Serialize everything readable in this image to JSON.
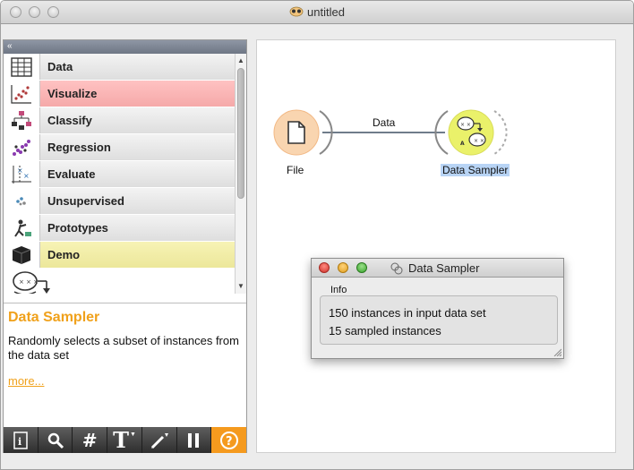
{
  "window": {
    "title": "untitled"
  },
  "sidebar": {
    "collapse_glyph": "«",
    "categories": [
      {
        "label": "Data",
        "icon": "data-table-icon"
      },
      {
        "label": "Visualize",
        "icon": "scatter-plot-icon",
        "color": "#f5a9a9"
      },
      {
        "label": "Classify",
        "icon": "tree-icon"
      },
      {
        "label": "Regression",
        "icon": "regression-icon"
      },
      {
        "label": "Evaluate",
        "icon": "evaluate-icon"
      },
      {
        "label": "Unsupervised",
        "icon": "unsupervised-icon"
      },
      {
        "label": "Prototypes",
        "icon": "prototypes-icon"
      },
      {
        "label": "Demo",
        "icon": "cube-icon",
        "color": "#ece79a"
      }
    ],
    "scroll_up": "▲",
    "scroll_down": "▼"
  },
  "description": {
    "title": "Data Sampler",
    "text": "Randomly selects a subset of instances from the data set",
    "more": "more..."
  },
  "toolbar": {
    "buttons": [
      "info-icon",
      "search-icon",
      "grid-icon",
      "text-icon",
      "pen-icon",
      "pause-icon",
      "help-icon"
    ],
    "text_glyph": "T",
    "grid_glyph": "#",
    "help_glyph": "?",
    "accent": "#f59a1e"
  },
  "canvas": {
    "nodes": [
      {
        "label": "File",
        "icon": "file-icon"
      },
      {
        "label": "Data Sampler",
        "icon": "data-sampler-icon"
      }
    ],
    "link_label": "Data"
  },
  "dialog": {
    "title": "Data Sampler",
    "group_label": "Info",
    "lines": [
      "150 instances in input data set",
      "15 sampled instances"
    ]
  }
}
